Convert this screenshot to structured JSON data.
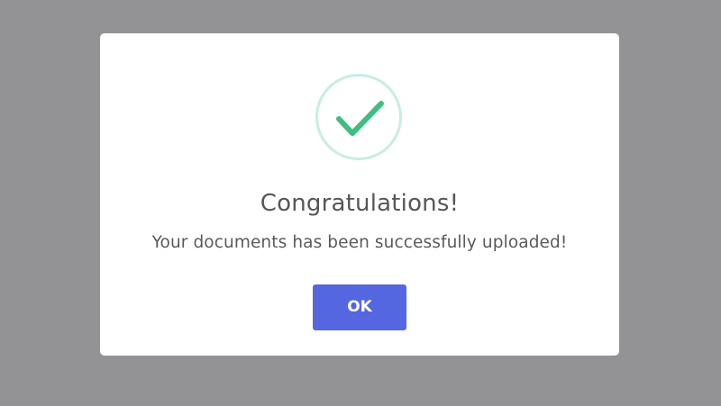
{
  "dialog": {
    "title": "Congratulations!",
    "message": "Your documents has been successfully uploaded!",
    "ok_label": "OK",
    "icon": "checkmark-circle-icon"
  },
  "colors": {
    "backdrop": "#939395",
    "dialog_background": "#ffffff",
    "check_stroke": "#3cbf7f",
    "ring_border": "#c8eedd",
    "button_background": "#5467e1",
    "button_text": "#ffffff",
    "text": "#575757"
  }
}
